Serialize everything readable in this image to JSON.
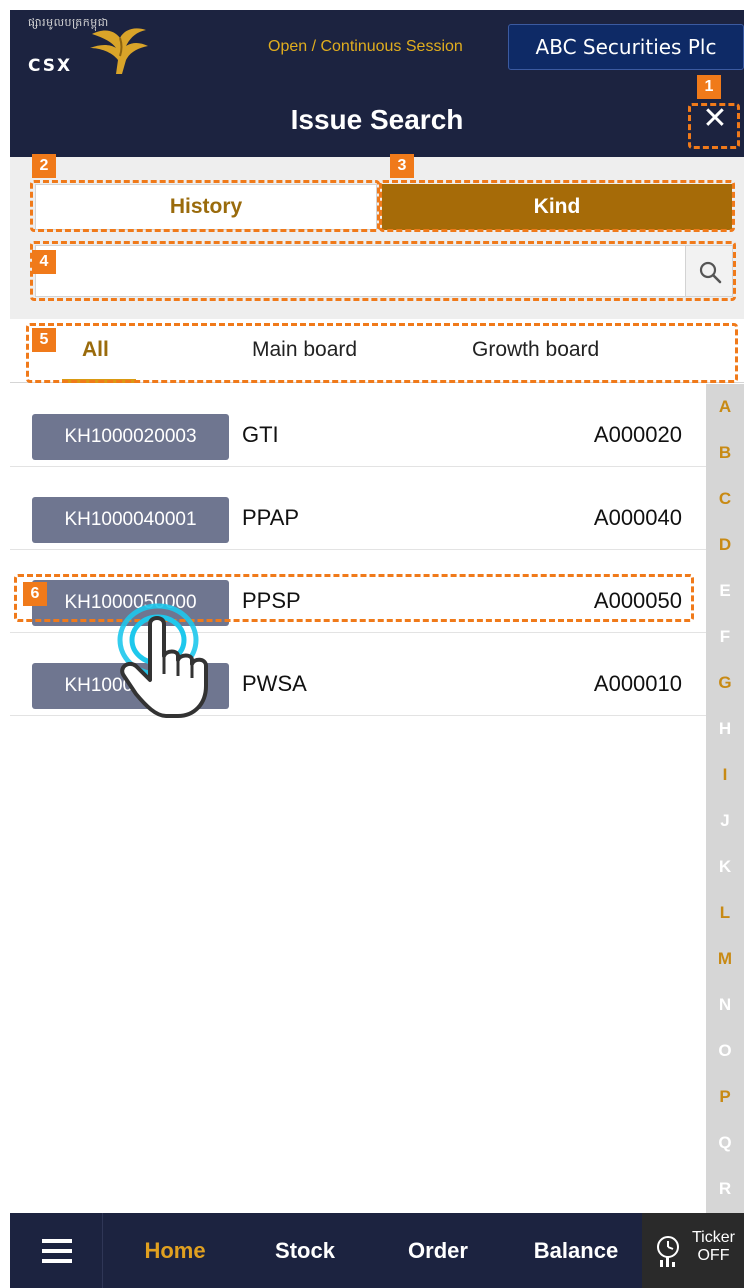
{
  "header": {
    "logo_script": "ផ្សារមូលបត្រកម្ពុជា",
    "logo_text": "CSX",
    "session_status": "Open / Continuous Session",
    "broker_name": "ABC Securities Plc",
    "title": "Issue Search",
    "close_label": "✕"
  },
  "search": {
    "tabs": [
      {
        "label": "History",
        "active": false
      },
      {
        "label": "Kind",
        "active": true
      }
    ],
    "input_value": "",
    "input_placeholder": ""
  },
  "board_tabs": [
    {
      "label": "All",
      "active": true
    },
    {
      "label": "Main board",
      "active": false
    },
    {
      "label": "Growth board",
      "active": false
    }
  ],
  "issues": [
    {
      "code": "KH1000020003",
      "name": "GTI",
      "number": "A000020"
    },
    {
      "code": "KH1000040001",
      "name": "PPAP",
      "number": "A000040"
    },
    {
      "code": "KH1000050000",
      "name": "PPSP",
      "number": "A000050"
    },
    {
      "code": "KH1000010007",
      "name": "PWSA",
      "number": "A000010"
    }
  ],
  "alphabet": [
    {
      "letter": "A",
      "on": true
    },
    {
      "letter": "B",
      "on": true
    },
    {
      "letter": "C",
      "on": true
    },
    {
      "letter": "D",
      "on": true
    },
    {
      "letter": "E",
      "on": false
    },
    {
      "letter": "F",
      "on": false
    },
    {
      "letter": "G",
      "on": true
    },
    {
      "letter": "H",
      "on": false
    },
    {
      "letter": "I",
      "on": true
    },
    {
      "letter": "J",
      "on": false
    },
    {
      "letter": "K",
      "on": false
    },
    {
      "letter": "L",
      "on": true
    },
    {
      "letter": "M",
      "on": true
    },
    {
      "letter": "N",
      "on": false
    },
    {
      "letter": "O",
      "on": false
    },
    {
      "letter": "P",
      "on": true
    },
    {
      "letter": "Q",
      "on": false
    },
    {
      "letter": "R",
      "on": false
    }
  ],
  "bottom_nav": {
    "items": [
      {
        "label": "Home",
        "active": true
      },
      {
        "label": "Stock",
        "active": false
      },
      {
        "label": "Order",
        "active": false
      },
      {
        "label": "Balance",
        "active": false
      }
    ],
    "ticker_label": "Ticker",
    "ticker_state": "OFF"
  },
  "annotations": [
    "1",
    "2",
    "3",
    "4",
    "5",
    "6"
  ],
  "colors": {
    "header_bg": "#1c2340",
    "accent": "#a66b08",
    "active_text": "#9a6b0c",
    "chip_bg": "#6f7690",
    "annotation": "#f07a1a",
    "tap_ripple": "#1ec8ec"
  },
  "icons": [
    "search-icon",
    "close-icon",
    "hamburger-menu-icon",
    "ticker-icon",
    "csx-bird-logo",
    "tap-hand-icon"
  ]
}
